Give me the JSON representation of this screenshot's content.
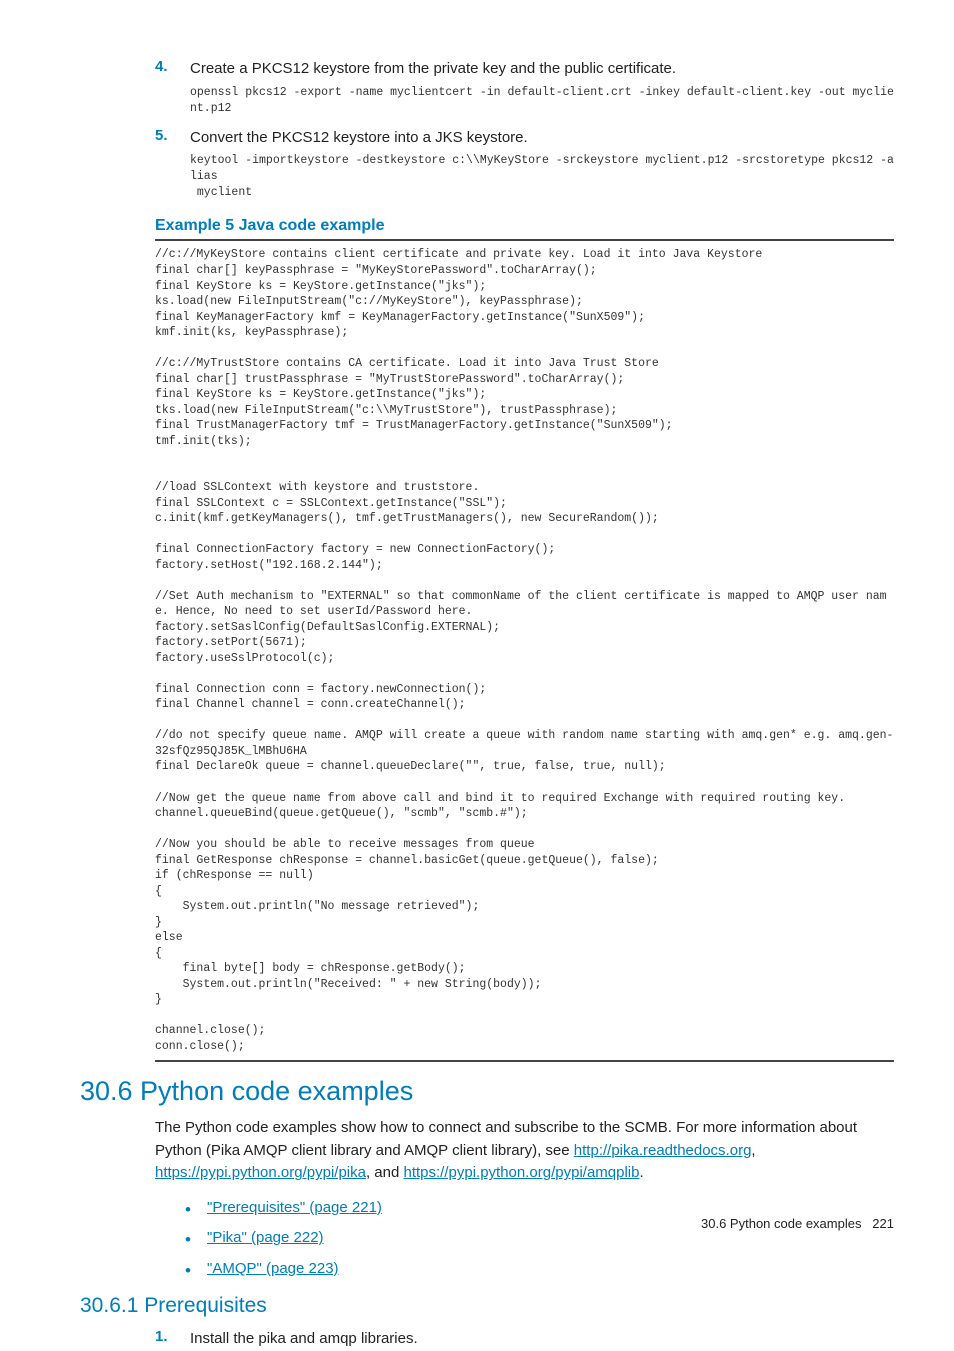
{
  "steps": {
    "s4": {
      "num": "4.",
      "text": "Create a PKCS12 keystore from the private key and the public certificate.",
      "code": "openssl pkcs12 -export -name myclientcert -in default-client.crt -inkey default-client.key -out myclient.p12"
    },
    "s5": {
      "num": "5.",
      "text": "Convert the PKCS12 keystore into a JKS keystore.",
      "code": "keytool -importkeystore -destkeystore c:\\\\MyKeyStore -srckeystore myclient.p12 -srcstoretype pkcs12 -alias\n myclient"
    }
  },
  "example": {
    "title": "Example 5 Java code example",
    "code": "//c://MyKeyStore contains client certificate and private key. Load it into Java Keystore\nfinal char[] keyPassphrase = \"MyKeyStorePassword\".toCharArray();\nfinal KeyStore ks = KeyStore.getInstance(\"jks\");\nks.load(new FileInputStream(\"c://MyKeyStore\"), keyPassphrase);\nfinal KeyManagerFactory kmf = KeyManagerFactory.getInstance(\"SunX509\");\nkmf.init(ks, keyPassphrase);\n\n//c://MyTrustStore contains CA certificate. Load it into Java Trust Store\nfinal char[] trustPassphrase = \"MyTrustStorePassword\".toCharArray();\nfinal KeyStore ks = KeyStore.getInstance(\"jks\");\ntks.load(new FileInputStream(\"c:\\\\MyTrustStore\"), trustPassphrase);\nfinal TrustManagerFactory tmf = TrustManagerFactory.getInstance(\"SunX509\");\ntmf.init(tks);\n\n\n//load SSLContext with keystore and truststore.\nfinal SSLContext c = SSLContext.getInstance(\"SSL\");\nc.init(kmf.getKeyManagers(), tmf.getTrustManagers(), new SecureRandom());\n\nfinal ConnectionFactory factory = new ConnectionFactory();\nfactory.setHost(\"192.168.2.144\");\n\n//Set Auth mechanism to \"EXTERNAL\" so that commonName of the client certificate is mapped to AMQP user name. Hence, No need to set userId/Password here.\nfactory.setSaslConfig(DefaultSaslConfig.EXTERNAL);\nfactory.setPort(5671);\nfactory.useSslProtocol(c);\n\nfinal Connection conn = factory.newConnection();\nfinal Channel channel = conn.createChannel();\n\n//do not specify queue name. AMQP will create a queue with random name starting with amq.gen* e.g. amq.gen-32sfQz95QJ85K_lMBhU6HA\nfinal DeclareOk queue = channel.queueDeclare(\"\", true, false, true, null);\n\n//Now get the queue name from above call and bind it to required Exchange with required routing key.\nchannel.queueBind(queue.getQueue(), \"scmb\", \"scmb.#\");\n\n//Now you should be able to receive messages from queue\nfinal GetResponse chResponse = channel.basicGet(queue.getQueue(), false);\nif (chResponse == null)\n{\n    System.out.println(\"No message retrieved\");\n}\nelse\n{\n    final byte[] body = chResponse.getBody();\n    System.out.println(\"Received: \" + new String(body));\n}\n\nchannel.close();\nconn.close();"
  },
  "section306": {
    "heading": "30.6 Python code examples",
    "intro_pre": "The Python code examples show how to connect and subscribe to the SCMB. For more information about Python (Pika AMQP client library and AMQP client library), see ",
    "link1": "http://pika.readthedocs.org",
    "comma1": ", ",
    "link2": "https://pypi.python.org/pypi/pika",
    "comma2": ", and ",
    "link3": "https://pypi.python.org/pypi/amqplib",
    "period": ".",
    "bullets": [
      "\"Prerequisites\" (page 221)",
      "\"Pika\" (page 222)",
      "\"AMQP\" (page 223)"
    ]
  },
  "section3061": {
    "heading": "30.6.1 Prerequisites",
    "step1": {
      "num": "1.",
      "text": "Install the pika and amqp libraries."
    }
  },
  "footer": {
    "section": "30.6 Python code examples",
    "page": "221"
  }
}
